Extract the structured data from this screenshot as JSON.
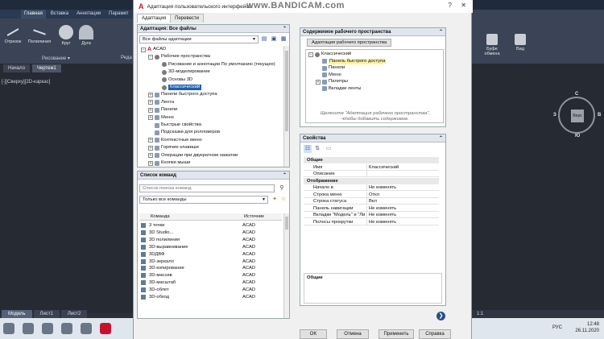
{
  "autocad": {
    "ribbon_tabs": [
      "Главная",
      "Вставка",
      "Аннотации",
      "Парамет"
    ],
    "active_ribbon_tab": "Главная",
    "tools": [
      {
        "label": "Отрезок",
        "icon": "line-icon"
      },
      {
        "label": "Полилиния",
        "icon": "polyline-icon"
      },
      {
        "label": "Круг",
        "icon": "circle-icon"
      },
      {
        "label": "Дуга",
        "icon": "arc-icon"
      }
    ],
    "panel_label": "Рисование ▾",
    "panel_label_2": "Реда",
    "drawing_tabs": [
      "Начало",
      "Чертеж1"
    ],
    "viewport_label": "[-][Сверху][2D-каркас]",
    "layout_tabs": [
      "Модель",
      "Лист1",
      "Лист2"
    ],
    "right_ribbon": {
      "items": [
        "Буфе обмена",
        "Вид"
      ]
    },
    "viewcube": {
      "face": "Верх",
      "n": "С",
      "e": "В",
      "w": "З",
      "s": "Ю"
    },
    "status_right": "1:1"
  },
  "taskbar": {
    "lang": "РУС",
    "time": "12:48",
    "date": "26.11.2020"
  },
  "dialog": {
    "title": "Адаптация пользовательского интерфейса",
    "watermark": "www.BANDICAM.com",
    "tabs": [
      "Адаптация",
      "Перевести"
    ],
    "active_tab": "Адаптация",
    "left_top": {
      "header": "Адаптация: Все файлы",
      "combo": "Все файлы адаптации",
      "tree": [
        {
          "label": "ACAD",
          "level": 0,
          "exp": "−",
          "icon": "acad"
        },
        {
          "label": "Рабочие пространства",
          "level": 1,
          "exp": "−",
          "icon": "gear"
        },
        {
          "label": "Рисование и аннотации По умолчанию (текущее)",
          "level": 2,
          "exp": "",
          "icon": "gear"
        },
        {
          "label": "3D-моделирование",
          "level": 2,
          "exp": "",
          "icon": "gear"
        },
        {
          "label": "Основы 3D",
          "level": 2,
          "exp": "",
          "icon": "gear"
        },
        {
          "label": "Классический",
          "level": 2,
          "exp": "",
          "icon": "gear",
          "selected": true
        },
        {
          "label": "Панели быстрого доступа",
          "level": 1,
          "exp": "+",
          "icon": "box"
        },
        {
          "label": "Лента",
          "level": 1,
          "exp": "+",
          "icon": "box"
        },
        {
          "label": "Панели",
          "level": 1,
          "exp": "+",
          "icon": "box"
        },
        {
          "label": "Меню",
          "level": 1,
          "exp": "+",
          "icon": "box"
        },
        {
          "label": "Быстрые свойства",
          "level": 1,
          "exp": "",
          "icon": "box"
        },
        {
          "label": "Подсказки для ролловеров",
          "level": 1,
          "exp": "",
          "icon": "box"
        },
        {
          "label": "Контекстные меню",
          "level": 1,
          "exp": "+",
          "icon": "box"
        },
        {
          "label": "Горячие клавиши",
          "level": 1,
          "exp": "+",
          "icon": "box"
        },
        {
          "label": "Операции при двукратном нажатии",
          "level": 1,
          "exp": "+",
          "icon": "box"
        },
        {
          "label": "Кнопки мыши",
          "level": 1,
          "exp": "+",
          "icon": "box"
        }
      ]
    },
    "commands": {
      "header": "Список команд",
      "search_placeholder": "Список поиска команд",
      "filter": "Только все команды",
      "col_command": "Команда",
      "col_source": "Источник",
      "rows": [
        {
          "name": "3 точки",
          "source": "ACAD"
        },
        {
          "name": "3D Studio...",
          "source": "ACAD"
        },
        {
          "name": "3D полилиния",
          "source": "ACAD"
        },
        {
          "name": "3D-выравнивание",
          "source": "ACAD"
        },
        {
          "name": "3DДВФ",
          "source": "ACAD"
        },
        {
          "name": "3D-зеркало",
          "source": "ACAD"
        },
        {
          "name": "3D-копирование",
          "source": "ACAD"
        },
        {
          "name": "3D-массив",
          "source": "ACAD"
        },
        {
          "name": "3D-масштаб",
          "source": "ACAD"
        },
        {
          "name": "3D-облет",
          "source": "ACAD"
        },
        {
          "name": "3D-обход",
          "source": "ACAD"
        }
      ]
    },
    "workspace_contents": {
      "header": "Содержимое рабочего пространства",
      "button": "Адаптация рабочего пространства",
      "tree": [
        {
          "label": "Классический",
          "level": 0,
          "exp": "−"
        },
        {
          "label": "Панель быстрого доступа",
          "level": 1,
          "exp": "",
          "highlight": true
        },
        {
          "label": "Панели",
          "level": 1,
          "exp": ""
        },
        {
          "label": "Меню",
          "level": 1,
          "exp": ""
        },
        {
          "label": "Палитры",
          "level": 1,
          "exp": "+"
        },
        {
          "label": "Вкладки ленты",
          "level": 1,
          "exp": ""
        }
      ],
      "hint": "Щелкните \"Адаптация рабочего пространства\", чтобы добавить содержимое."
    },
    "properties": {
      "header": "Свойства",
      "cat_general": "Общие",
      "general": [
        {
          "key": "Имя",
          "value": "Классический"
        },
        {
          "key": "Описание",
          "value": ""
        }
      ],
      "cat_display": "Отображение",
      "display": [
        {
          "key": "Начало в",
          "value": "Не изменять"
        },
        {
          "key": "Строка меню",
          "value": "Откл"
        },
        {
          "key": "Строка статуса",
          "value": "Вкл"
        },
        {
          "key": "Панель навигации",
          "value": "Не изменять"
        },
        {
          "key": "Вкладки \"Модель\" и \"Ли",
          "value": "Не изменять"
        },
        {
          "key": "Полосы прокрутки",
          "value": "Не изменять"
        }
      ],
      "desc_title": "Общие"
    },
    "buttons": {
      "ok": "OK",
      "cancel": "Отмена",
      "apply": "Применить",
      "help": "Справка"
    }
  }
}
